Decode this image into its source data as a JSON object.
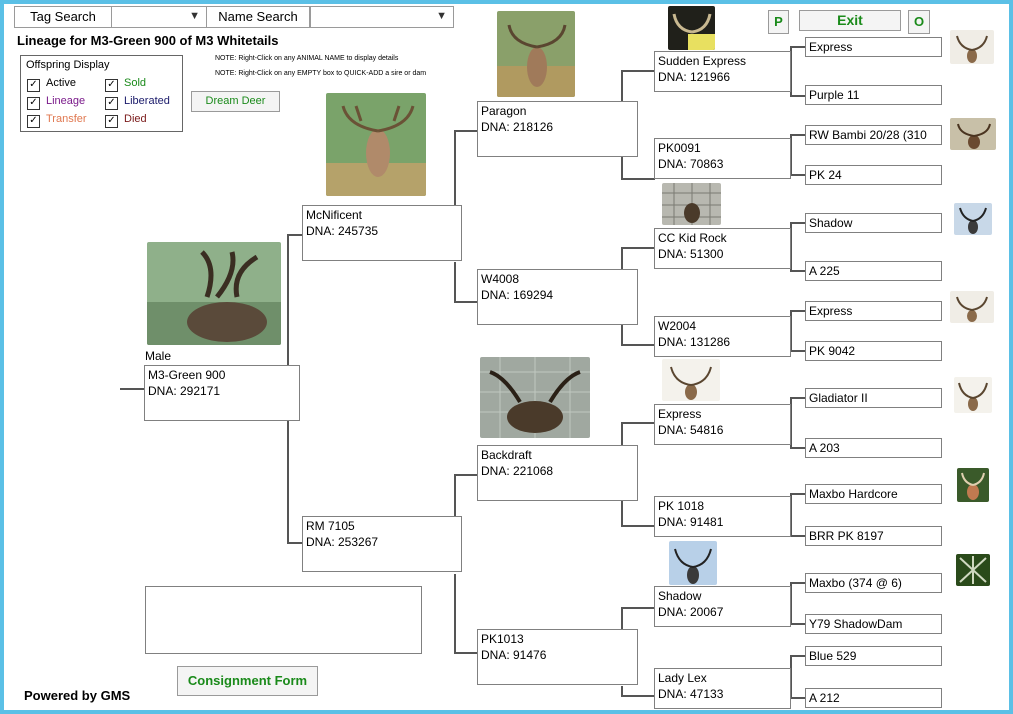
{
  "toolbar": {
    "tag_search_label": "Tag Search",
    "name_search_label": "Name Search",
    "p_button": "P",
    "exit_button": "Exit",
    "o_button": "O"
  },
  "header": {
    "title": "Lineage for M3-Green 900 of M3 Whitetails",
    "note1": "NOTE: Right-Click on any ANIMAL NAME to display details",
    "note2": "NOTE: Right-Click on any EMPTY box to QUICK-ADD a sire or dam"
  },
  "offspring": {
    "title": "Offspring Display",
    "items": [
      {
        "label": "Active",
        "color": "#000000"
      },
      {
        "label": "Lineage",
        "color": "#7a1a8a"
      },
      {
        "label": "Transfer",
        "color": "#e07850"
      },
      {
        "label": "Sold",
        "color": "#1a8a1a"
      },
      {
        "label": "Liberated",
        "color": "#1a1a6a"
      },
      {
        "label": "Died",
        "color": "#7a1a1a"
      }
    ]
  },
  "dream_deer_button": "Dream Deer",
  "consignment_button": "Consignment Form",
  "powered_by": "Powered by GMS",
  "subject": {
    "sex": "Male",
    "name": "M3-Green 900",
    "dna": "DNA: 292171"
  },
  "gen1": [
    {
      "name": "McNificent",
      "dna": "DNA: 245735"
    },
    {
      "name": "RM 7105",
      "dna": "DNA: 253267"
    }
  ],
  "gen2": [
    {
      "name": "Paragon",
      "dna": "DNA: 218126"
    },
    {
      "name": "W4008",
      "dna": "DNA: 169294"
    },
    {
      "name": "Backdraft",
      "dna": "DNA: 221068"
    },
    {
      "name": "PK1013",
      "dna": "DNA: 91476"
    }
  ],
  "gen3": [
    {
      "name": "Sudden Express",
      "dna": "DNA: 121966"
    },
    {
      "name": "PK0091",
      "dna": "DNA: 70863"
    },
    {
      "name": "CC Kid Rock",
      "dna": "DNA: 51300"
    },
    {
      "name": "W2004",
      "dna": "DNA: 131286"
    },
    {
      "name": "Express",
      "dna": "DNA: 54816"
    },
    {
      "name": "PK 1018",
      "dna": "DNA: 91481"
    },
    {
      "name": "Shadow",
      "dna": "DNA: 20067"
    },
    {
      "name": "Lady Lex",
      "dna": "DNA: 47133"
    }
  ],
  "gen4": [
    "Express",
    "Purple 11",
    "RW Bambi 20/28 (310",
    "PK 24",
    "Shadow",
    "A 225",
    "Express",
    "PK 9042",
    "Gladiator II",
    "A 203",
    "Maxbo Hardcore",
    "BRR PK 8197",
    "Maxbo (374 @ 6)",
    "Y79 ShadowDam",
    "Blue 529",
    "A 212"
  ],
  "colors": {
    "accent_green": "#1a8a1a",
    "frame_blue": "#5bc0e6",
    "line_gray": "#555555"
  }
}
